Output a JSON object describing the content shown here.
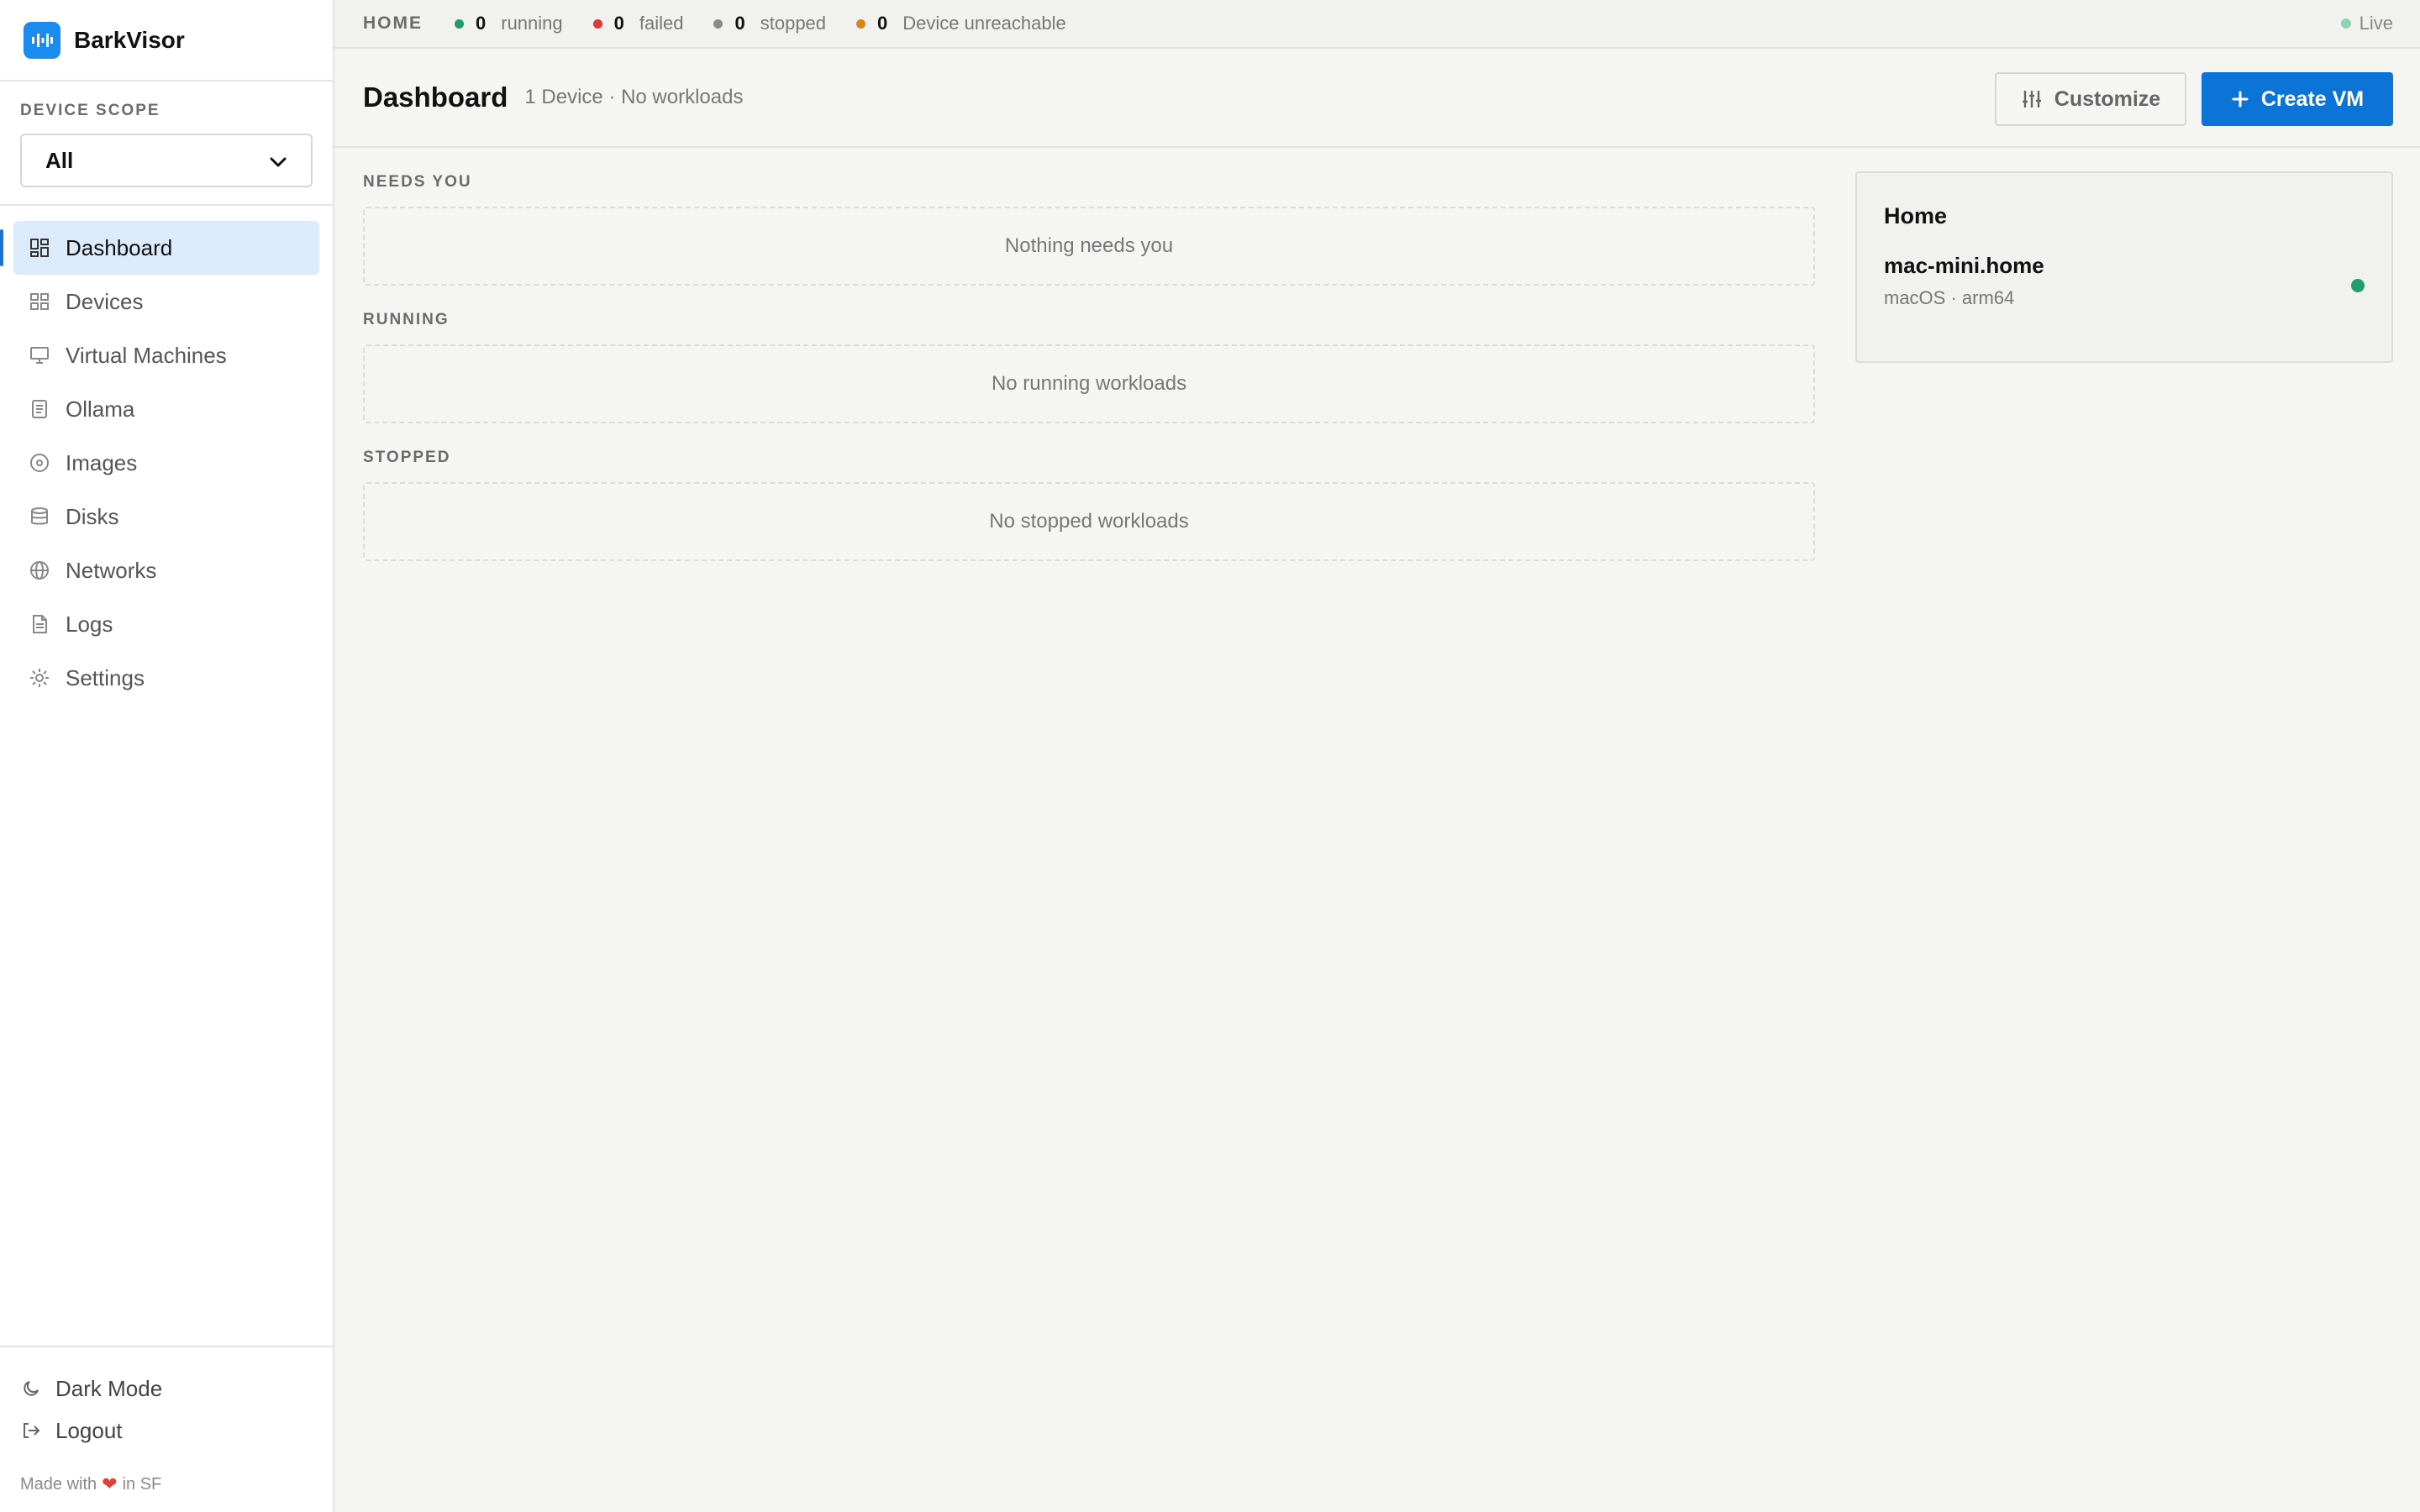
{
  "app": {
    "name": "BarkVisor"
  },
  "sidebar": {
    "scope_label": "DEVICE SCOPE",
    "scope_value": "All",
    "items": [
      {
        "label": "Dashboard",
        "icon": "dashboard-icon",
        "active": true
      },
      {
        "label": "Devices",
        "icon": "devices-icon"
      },
      {
        "label": "Virtual Machines",
        "icon": "monitor-icon"
      },
      {
        "label": "Ollama",
        "icon": "ollama-icon"
      },
      {
        "label": "Images",
        "icon": "disc-icon"
      },
      {
        "label": "Disks",
        "icon": "database-icon"
      },
      {
        "label": "Networks",
        "icon": "globe-icon"
      },
      {
        "label": "Logs",
        "icon": "file-icon"
      },
      {
        "label": "Settings",
        "icon": "gear-icon"
      }
    ],
    "dark_mode_label": "Dark Mode",
    "logout_label": "Logout",
    "made_with_prefix": "Made with",
    "made_with_suffix": "in SF"
  },
  "topbar": {
    "crumb": "HOME",
    "stats": [
      {
        "count": "0",
        "label": "running",
        "color": "#1f9d6b"
      },
      {
        "count": "0",
        "label": "failed",
        "color": "#d93a3a"
      },
      {
        "count": "0",
        "label": "stopped",
        "color": "#8a8a8a"
      },
      {
        "count": "0",
        "label": "Device unreachable",
        "color": "#d9860f"
      }
    ],
    "live_label": "Live"
  },
  "header": {
    "title": "Dashboard",
    "subtitle": "1 Device · No workloads",
    "customize_label": "Customize",
    "create_label": "Create VM"
  },
  "sections": [
    {
      "label": "NEEDS YOU",
      "empty_text": "Nothing needs you"
    },
    {
      "label": "RUNNING",
      "empty_text": "No running workloads"
    },
    {
      "label": "STOPPED",
      "empty_text": "No stopped workloads"
    }
  ],
  "device_panel": {
    "title": "Home",
    "device_name": "mac-mini.home",
    "device_meta": "macOS · arm64",
    "status_color": "#1f9d6b"
  },
  "colors": {
    "accent": "#0b74d6",
    "active_bg": "#dcebfb"
  }
}
